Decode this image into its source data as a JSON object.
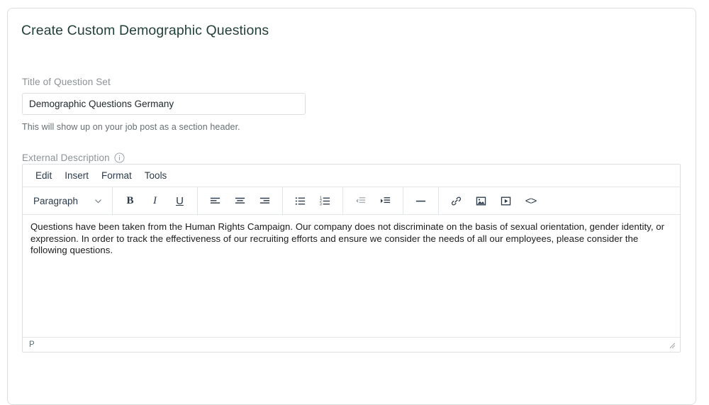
{
  "page": {
    "title": "Create Custom Demographic Questions"
  },
  "title_field": {
    "label": "Title of Question Set",
    "value": "Demographic Questions Germany",
    "placeholder": "",
    "help_text": "This will show up on your job post as a section header."
  },
  "description_field": {
    "label": "External Description",
    "info_icon": "info-icon"
  },
  "editor": {
    "menubar": [
      {
        "label": "Edit"
      },
      {
        "label": "Insert"
      },
      {
        "label": "Format"
      },
      {
        "label": "Tools"
      }
    ],
    "format_select": {
      "value": "Paragraph",
      "chevron": "chevron-down-icon"
    },
    "toolbar_groups": [
      {
        "buttons": [
          {
            "name": "bold-button",
            "glyph": "B",
            "disabled": false
          },
          {
            "name": "italic-button",
            "glyph": "I",
            "disabled": false
          },
          {
            "name": "underline-button",
            "glyph": "U",
            "disabled": false
          }
        ]
      },
      {
        "buttons": [
          {
            "name": "align-left-button",
            "glyph": "",
            "disabled": false
          },
          {
            "name": "align-center-button",
            "glyph": "",
            "disabled": false
          },
          {
            "name": "align-right-button",
            "glyph": "",
            "disabled": false
          }
        ]
      },
      {
        "buttons": [
          {
            "name": "bullet-list-button",
            "glyph": "",
            "disabled": false
          },
          {
            "name": "numbered-list-button",
            "glyph": "",
            "disabled": false
          }
        ]
      },
      {
        "buttons": [
          {
            "name": "outdent-button",
            "glyph": "",
            "disabled": true
          },
          {
            "name": "indent-button",
            "glyph": "",
            "disabled": false
          }
        ]
      },
      {
        "buttons": [
          {
            "name": "horizontal-rule-button",
            "glyph": "",
            "disabled": false
          }
        ]
      },
      {
        "buttons": [
          {
            "name": "insert-link-button",
            "glyph": "",
            "disabled": false
          },
          {
            "name": "insert-image-button",
            "glyph": "",
            "disabled": false
          },
          {
            "name": "insert-video-button",
            "glyph": "",
            "disabled": false
          },
          {
            "name": "source-code-button",
            "glyph": "<>",
            "disabled": false
          }
        ]
      }
    ],
    "content": "Questions have been taken from the Human Rights Campaign. Our company does not discriminate on the basis of sexual orientation, gender identity, or expression. In order to track the effectiveness of our recruiting efforts and ensure we consider the needs of all our employees, please consider the following questions.",
    "statusbar": {
      "element_path": "P",
      "resize_handle": "resize-grip-icon"
    }
  },
  "colors": {
    "title": "#23403a",
    "label": "#8c9396",
    "border": "#dcdfe1",
    "toolbar_icon": "#2b3a4a",
    "disabled_icon": "#a7aeb4"
  }
}
